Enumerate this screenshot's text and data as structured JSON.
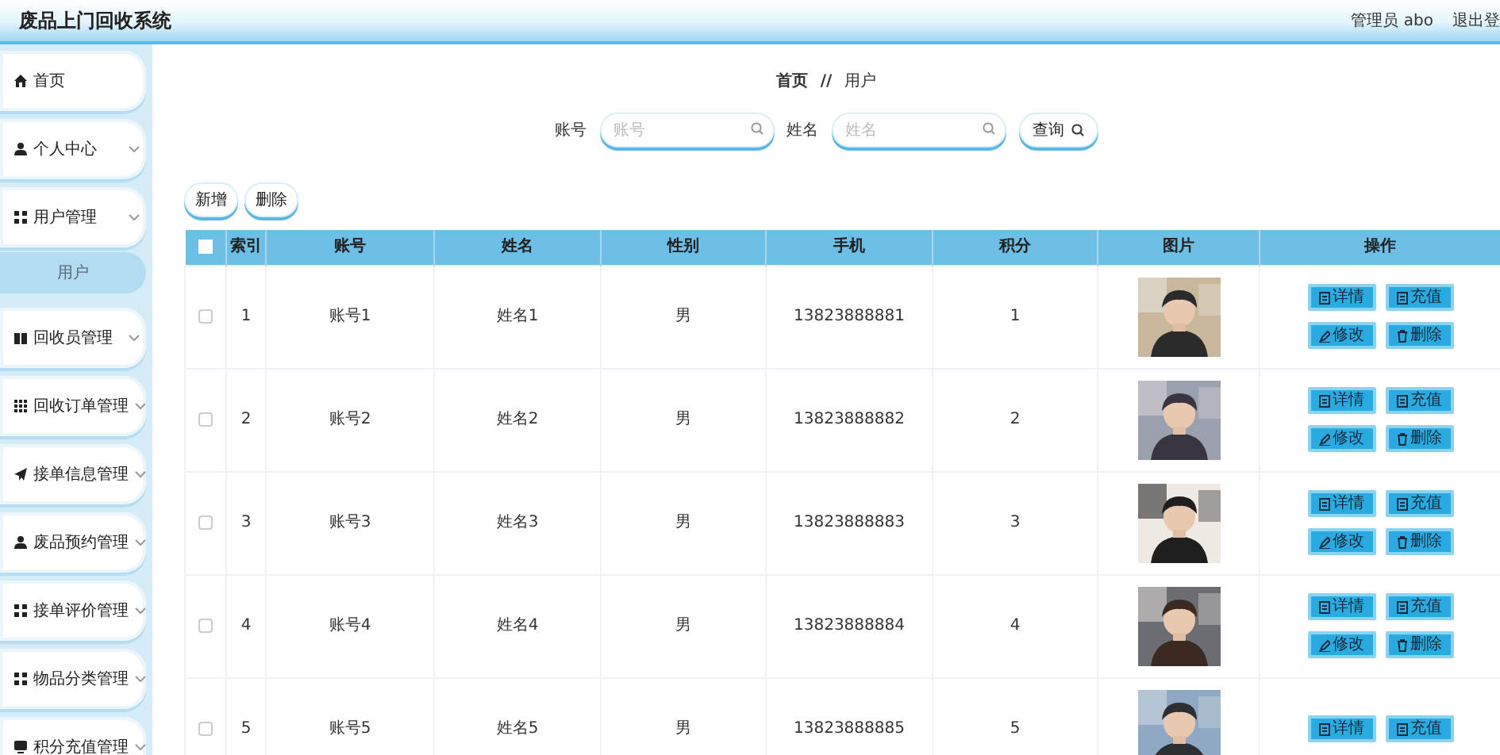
{
  "header": {
    "title": "废品上门回收系统",
    "user": "管理员 abo",
    "logout": "退出登"
  },
  "sidebar": {
    "items": [
      {
        "label": "首页",
        "kind": "link"
      },
      {
        "label": "个人中心",
        "kind": "menu"
      },
      {
        "label": "用户管理",
        "kind": "menu",
        "children": [
          {
            "label": "用户",
            "selected": true
          }
        ]
      },
      {
        "label": "回收员管理",
        "kind": "menu"
      },
      {
        "label": "回收订单管理",
        "kind": "menu"
      },
      {
        "label": "接单信息管理",
        "kind": "menu"
      },
      {
        "label": "废品预约管理",
        "kind": "menu"
      },
      {
        "label": "接单评价管理",
        "kind": "menu"
      },
      {
        "label": "物品分类管理",
        "kind": "menu"
      },
      {
        "label": "积分充值管理",
        "kind": "menu"
      }
    ]
  },
  "breadcrumb": {
    "items": [
      "首页",
      "用户"
    ],
    "separator": "//"
  },
  "search": {
    "fields": [
      {
        "label": "账号",
        "placeholder": "账号"
      },
      {
        "label": "姓名",
        "placeholder": "姓名"
      }
    ],
    "button": "查询"
  },
  "toolbar": [
    "新增",
    "删除"
  ],
  "table": {
    "select_all": {
      "checked": false
    },
    "columns": [
      "索引",
      "账号",
      "姓名",
      "性别",
      "手机",
      "积分",
      "图片",
      "操作"
    ],
    "rows": [
      {
        "checked": false,
        "index": "1",
        "account": "账号1",
        "name": "姓名1",
        "gender": "男",
        "phone": "13823888881",
        "points": "1",
        "photo": {
          "kind": "picture"
        },
        "actions": [
          "详情",
          "充值",
          "修改",
          "删除"
        ]
      },
      {
        "checked": false,
        "index": "2",
        "account": "账号2",
        "name": "姓名2",
        "gender": "男",
        "phone": "13823888882",
        "points": "2",
        "photo": {
          "kind": "picture"
        },
        "actions": [
          "详情",
          "充值",
          "修改",
          "删除"
        ]
      },
      {
        "checked": false,
        "index": "3",
        "account": "账号3",
        "name": "姓名3",
        "gender": "男",
        "phone": "13823888883",
        "points": "3",
        "photo": {
          "kind": "picture"
        },
        "actions": [
          "详情",
          "充值",
          "修改",
          "删除"
        ]
      },
      {
        "checked": false,
        "index": "4",
        "account": "账号4",
        "name": "姓名4",
        "gender": "男",
        "phone": "13823888884",
        "points": "4",
        "photo": {
          "kind": "picture"
        },
        "actions": [
          "详情",
          "充值",
          "修改",
          "删除"
        ]
      },
      {
        "checked": false,
        "index": "5",
        "account": "账号5",
        "name": "姓名5",
        "gender": "男",
        "phone": "13823888885",
        "points": "5",
        "photo": {
          "kind": "picture"
        },
        "actions": [
          "详情",
          "充值"
        ]
      }
    ]
  }
}
